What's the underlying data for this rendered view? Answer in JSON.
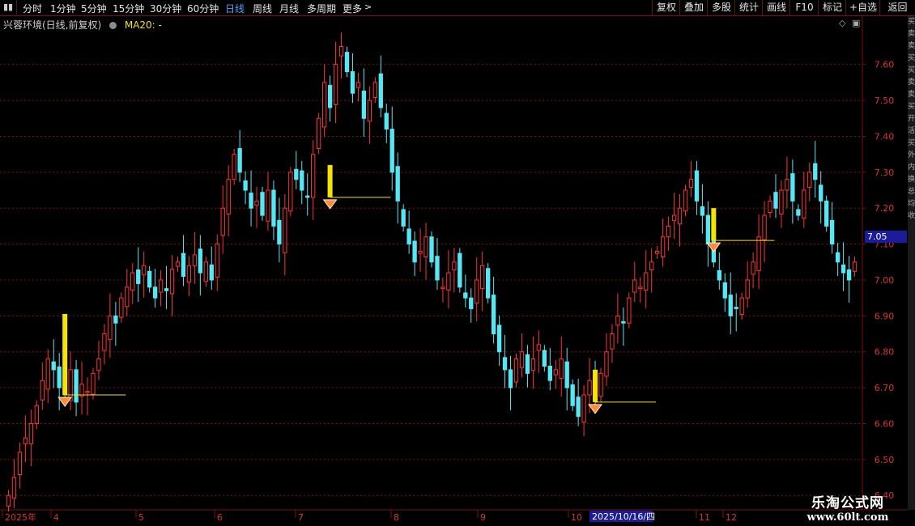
{
  "toolbar": {
    "periods": [
      "分时",
      "1分钟",
      "5分钟",
      "15分钟",
      "30分钟",
      "60分钟",
      "日线",
      "周线",
      "月线",
      "多周期",
      "更多"
    ],
    "active_period": "日线",
    "more_icon": "chevron-right-icon",
    "tools": [
      "复权",
      "叠加",
      "多股",
      "统计",
      "画线",
      "F10",
      "标记",
      "+自选",
      "返回"
    ]
  },
  "chart_header": {
    "stock_name": "兴蓉环境(日线,前复权)",
    "ma_label": "MA20: -"
  },
  "current_price": "7.05",
  "x_labels": [
    "2025年",
    "4",
    "5",
    "6",
    "7",
    "8",
    "9",
    "10",
    "11",
    "12"
  ],
  "x_highlight": "2025/10/16/四",
  "side_panel_text": "买卖卖买买卖卖买开活买外内换总均收",
  "watermark": {
    "line1": "乐淘公式网",
    "line2": "www.60lt.com"
  },
  "colors": {
    "up": "#ff3333",
    "down": "#54e8f5",
    "signal": "#f5e400",
    "grid": "#7a1010",
    "accent": "#3ea7ff"
  },
  "chart_data": {
    "type": "candlestick",
    "y_ticks": [
      "7.60",
      "7.50",
      "7.40",
      "7.30",
      "7.20",
      "7.10",
      "7.00",
      "6.90",
      "6.80",
      "6.70",
      "6.60",
      "6.50",
      "6.40"
    ],
    "ylim": [
      6.36,
      7.73
    ],
    "signals": [
      {
        "date": "2025/03",
        "price": 6.68
      },
      {
        "date": "2025/07",
        "price": 7.23
      },
      {
        "date": "2025/10",
        "price": 6.66
      },
      {
        "date": "2025/11",
        "price": 7.11
      }
    ],
    "close": [
      6.4,
      6.45,
      6.52,
      6.56,
      6.6,
      6.65,
      6.72,
      6.78,
      6.75,
      6.7,
      6.68,
      6.75,
      6.66,
      6.71,
      6.69,
      6.74,
      6.78,
      6.85,
      6.9,
      6.88,
      6.95,
      6.98,
      7.02,
      6.99,
      7.04,
      6.98,
      6.95,
      7.0,
      6.97,
      7.03,
      7.05,
      7.01,
      7.04,
      7.07,
      7.02,
      7.05,
      7.0,
      7.1,
      7.2,
      7.28,
      7.35,
      7.3,
      7.25,
      7.2,
      7.22,
      7.18,
      7.25,
      7.15,
      7.1,
      7.2,
      7.3,
      7.28,
      7.25,
      7.23,
      7.35,
      7.45,
      7.55,
      7.48,
      7.6,
      7.65,
      7.58,
      7.52,
      7.55,
      7.45,
      7.5,
      7.55,
      7.48,
      7.42,
      7.3,
      7.22,
      7.15,
      7.1,
      7.05,
      7.08,
      7.12,
      7.05,
      7.0,
      6.98,
      7.02,
      7.05,
      6.98,
      6.95,
      6.92,
      7.0,
      7.04,
      6.95,
      6.85,
      6.8,
      6.75,
      6.7,
      6.78,
      6.8,
      6.74,
      6.78,
      6.82,
      6.76,
      6.72,
      6.75,
      6.78,
      6.7,
      6.65,
      6.62,
      6.68,
      6.72,
      6.7,
      6.74,
      6.8,
      6.85,
      6.9,
      6.88,
      6.95,
      7.0,
      6.98,
      7.02,
      7.05,
      7.08,
      7.12,
      7.15,
      7.18,
      7.2,
      7.25,
      7.28,
      7.22,
      7.18,
      7.1,
      7.05,
      7.0,
      6.95,
      6.9,
      6.92,
      6.95,
      7.0,
      7.05,
      7.12,
      7.18,
      7.22,
      7.2,
      7.25,
      7.28,
      7.22,
      7.18,
      7.25,
      7.3,
      7.28,
      7.22,
      7.15,
      7.1,
      7.05,
      7.02,
      7.0,
      7.05
    ]
  }
}
